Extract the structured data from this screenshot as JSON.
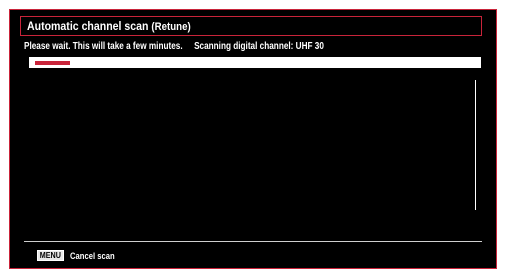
{
  "header": {
    "title": "Automatic channel scan",
    "subtitle": "(Retune)"
  },
  "status": {
    "message": "Please wait. This will take a few minutes.",
    "scanning_text": "Scanning digital channel: UHF 30"
  },
  "progress": {
    "fraction": 0.08
  },
  "footer": {
    "key_label": "MENU",
    "action_label": "Cancel scan"
  },
  "colors": {
    "accent": "#c9243a",
    "background": "#000000",
    "text": "#ffffff"
  }
}
